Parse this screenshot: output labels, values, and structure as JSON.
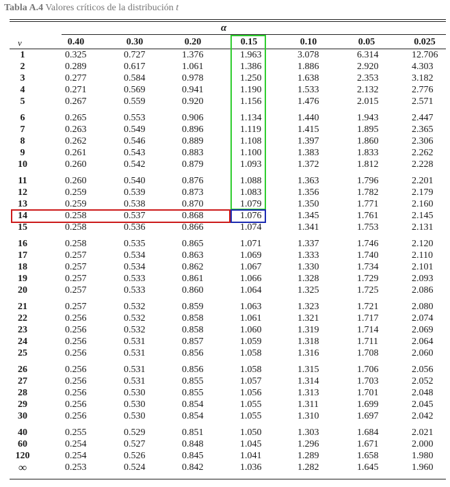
{
  "title": {
    "label": "Tabla A.4",
    "text": "Valores críticos de la distribución",
    "symbol": "t"
  },
  "header": {
    "alpha_symbol": "α",
    "v_symbol": "v",
    "columns": [
      "0.40",
      "0.30",
      "0.20",
      "0.15",
      "0.10",
      "0.05",
      "0.025"
    ]
  },
  "highlight": {
    "column": "0.15",
    "row": "14",
    "column_color": "#2ecc2e",
    "row_color": "#cc1a1a",
    "cell_color": "#1a2ab0"
  },
  "rows": [
    {
      "v": "1",
      "values": [
        "0.325",
        "0.727",
        "1.376",
        "1.963",
        "3.078",
        "6.314",
        "12.706"
      ]
    },
    {
      "v": "2",
      "values": [
        "0.289",
        "0.617",
        "1.061",
        "1.386",
        "1.886",
        "2.920",
        "4.303"
      ]
    },
    {
      "v": "3",
      "values": [
        "0.277",
        "0.584",
        "0.978",
        "1.250",
        "1.638",
        "2.353",
        "3.182"
      ]
    },
    {
      "v": "4",
      "values": [
        "0.271",
        "0.569",
        "0.941",
        "1.190",
        "1.533",
        "2.132",
        "2.776"
      ]
    },
    {
      "v": "5",
      "values": [
        "0.267",
        "0.559",
        "0.920",
        "1.156",
        "1.476",
        "2.015",
        "2.571"
      ]
    },
    {
      "v": "6",
      "values": [
        "0.265",
        "0.553",
        "0.906",
        "1.134",
        "1.440",
        "1.943",
        "2.447"
      ]
    },
    {
      "v": "7",
      "values": [
        "0.263",
        "0.549",
        "0.896",
        "1.119",
        "1.415",
        "1.895",
        "2.365"
      ]
    },
    {
      "v": "8",
      "values": [
        "0.262",
        "0.546",
        "0.889",
        "1.108",
        "1.397",
        "1.860",
        "2.306"
      ]
    },
    {
      "v": "9",
      "values": [
        "0.261",
        "0.543",
        "0.883",
        "1.100",
        "1.383",
        "1.833",
        "2.262"
      ]
    },
    {
      "v": "10",
      "values": [
        "0.260",
        "0.542",
        "0.879",
        "1.093",
        "1.372",
        "1.812",
        "2.228"
      ]
    },
    {
      "v": "11",
      "values": [
        "0.260",
        "0.540",
        "0.876",
        "1.088",
        "1.363",
        "1.796",
        "2.201"
      ]
    },
    {
      "v": "12",
      "values": [
        "0.259",
        "0.539",
        "0.873",
        "1.083",
        "1.356",
        "1.782",
        "2.179"
      ]
    },
    {
      "v": "13",
      "values": [
        "0.259",
        "0.538",
        "0.870",
        "1.079",
        "1.350",
        "1.771",
        "2.160"
      ]
    },
    {
      "v": "14",
      "values": [
        "0.258",
        "0.537",
        "0.868",
        "1.076",
        "1.345",
        "1.761",
        "2.145"
      ]
    },
    {
      "v": "15",
      "values": [
        "0.258",
        "0.536",
        "0.866",
        "1.074",
        "1.341",
        "1.753",
        "2.131"
      ]
    },
    {
      "v": "16",
      "values": [
        "0.258",
        "0.535",
        "0.865",
        "1.071",
        "1.337",
        "1.746",
        "2.120"
      ]
    },
    {
      "v": "17",
      "values": [
        "0.257",
        "0.534",
        "0.863",
        "1.069",
        "1.333",
        "1.740",
        "2.110"
      ]
    },
    {
      "v": "18",
      "values": [
        "0.257",
        "0.534",
        "0.862",
        "1.067",
        "1.330",
        "1.734",
        "2.101"
      ]
    },
    {
      "v": "19",
      "values": [
        "0.257",
        "0.533",
        "0.861",
        "1.066",
        "1.328",
        "1.729",
        "2.093"
      ]
    },
    {
      "v": "20",
      "values": [
        "0.257",
        "0.533",
        "0.860",
        "1.064",
        "1.325",
        "1.725",
        "2.086"
      ]
    },
    {
      "v": "21",
      "values": [
        "0.257",
        "0.532",
        "0.859",
        "1.063",
        "1.323",
        "1.721",
        "2.080"
      ]
    },
    {
      "v": "22",
      "values": [
        "0.256",
        "0.532",
        "0.858",
        "1.061",
        "1.321",
        "1.717",
        "2.074"
      ]
    },
    {
      "v": "23",
      "values": [
        "0.256",
        "0.532",
        "0.858",
        "1.060",
        "1.319",
        "1.714",
        "2.069"
      ]
    },
    {
      "v": "24",
      "values": [
        "0.256",
        "0.531",
        "0.857",
        "1.059",
        "1.318",
        "1.711",
        "2.064"
      ]
    },
    {
      "v": "25",
      "values": [
        "0.256",
        "0.531",
        "0.856",
        "1.058",
        "1.316",
        "1.708",
        "2.060"
      ]
    },
    {
      "v": "26",
      "values": [
        "0.256",
        "0.531",
        "0.856",
        "1.058",
        "1.315",
        "1.706",
        "2.056"
      ]
    },
    {
      "v": "27",
      "values": [
        "0.256",
        "0.531",
        "0.855",
        "1.057",
        "1.314",
        "1.703",
        "2.052"
      ]
    },
    {
      "v": "28",
      "values": [
        "0.256",
        "0.530",
        "0.855",
        "1.056",
        "1.313",
        "1.701",
        "2.048"
      ]
    },
    {
      "v": "29",
      "values": [
        "0.256",
        "0.530",
        "0.854",
        "1.055",
        "1.311",
        "1.699",
        "2.045"
      ]
    },
    {
      "v": "30",
      "values": [
        "0.256",
        "0.530",
        "0.854",
        "1.055",
        "1.310",
        "1.697",
        "2.042"
      ]
    },
    {
      "v": "40",
      "values": [
        "0.255",
        "0.529",
        "0.851",
        "1.050",
        "1.303",
        "1.684",
        "2.021"
      ]
    },
    {
      "v": "60",
      "values": [
        "0.254",
        "0.527",
        "0.848",
        "1.045",
        "1.296",
        "1.671",
        "2.000"
      ]
    },
    {
      "v": "120",
      "values": [
        "0.254",
        "0.526",
        "0.845",
        "1.041",
        "1.289",
        "1.658",
        "1.980"
      ]
    },
    {
      "v": "∞",
      "values": [
        "0.253",
        "0.524",
        "0.842",
        "1.036",
        "1.282",
        "1.645",
        "1.960"
      ]
    }
  ]
}
